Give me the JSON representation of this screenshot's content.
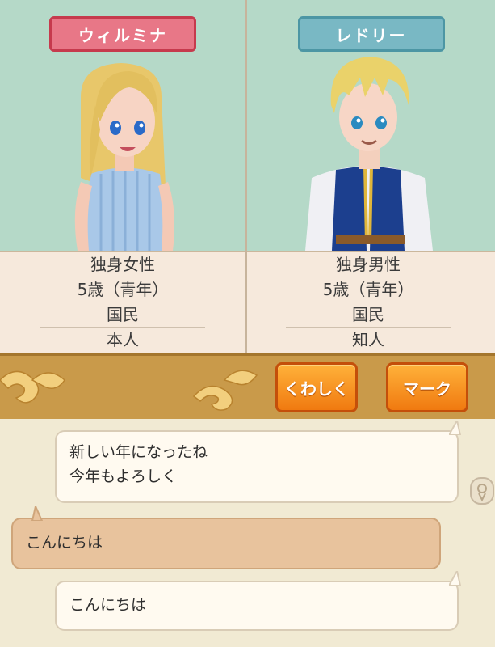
{
  "left_character": {
    "name": "ウィルミナ",
    "status": [
      "独身女性",
      "5歳（青年）",
      "国民",
      "本人"
    ]
  },
  "right_character": {
    "name": "レドリー",
    "status": [
      "独身男性",
      "5歳（青年）",
      "国民",
      "知人"
    ]
  },
  "buttons": {
    "details": "くわしく",
    "mark": "マーク"
  },
  "messages": [
    {
      "line1": "新しい年になったね",
      "line2": "今年もよろしく"
    },
    {
      "line1": "こんにちは"
    },
    {
      "line1": "こんにちは"
    }
  ],
  "colors": {
    "name_left": "#e87787",
    "name_right": "#79b8c4",
    "button": "#f58a1a",
    "bar": "#c99a4a",
    "portrait_bg": "#b5d9c8"
  }
}
